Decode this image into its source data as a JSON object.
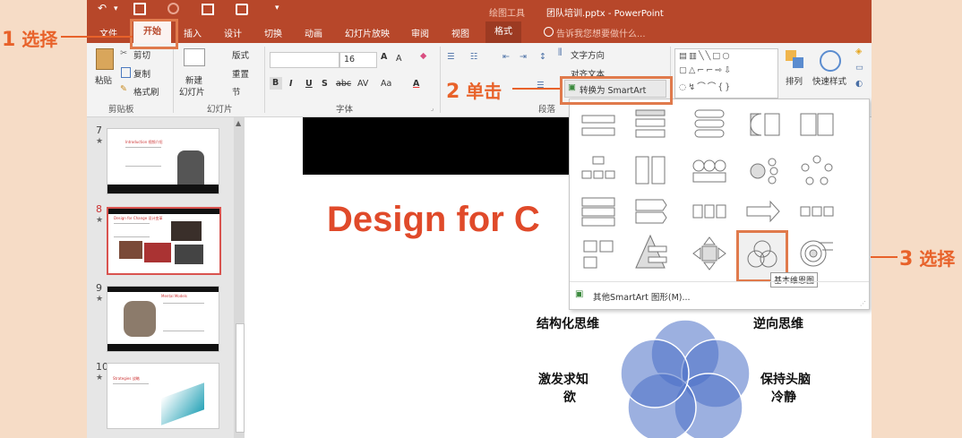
{
  "callouts": {
    "c1": {
      "num": "1",
      "text": "选择"
    },
    "c2": {
      "num": "2",
      "text": "单击"
    },
    "c3": {
      "num": "3",
      "text": "选择"
    }
  },
  "titlebar": {
    "undo": "↶",
    "save": "🖫",
    "tool_context": "绘图工具",
    "title": "团队培训.pptx - PowerPoint"
  },
  "tabs": {
    "file": "文件",
    "home": "开始",
    "insert": "插入",
    "design": "设计",
    "transitions": "切换",
    "animations": "动画",
    "slideshow": "幻灯片放映",
    "review": "审阅",
    "view": "视图",
    "format": "格式",
    "tellme": "告诉我您想要做什么..."
  },
  "ribbon": {
    "clipboard": {
      "paste": "粘贴",
      "cut": "剪切",
      "copy": "复制",
      "format_painter": "格式刷",
      "label": "剪贴板"
    },
    "slides": {
      "layout": "版式",
      "reset": "重置",
      "new_slide": "新建",
      "new_slide2": "幻灯片",
      "section": "节",
      "label": "幻灯片"
    },
    "font": {
      "size": "16",
      "label": "字体",
      "aa": "Aa"
    },
    "paragraph": {
      "text_direction": "文字方向",
      "align_text": "对齐文本",
      "convert_smartart": "转换为 SmartArt",
      "label": "段落"
    },
    "drawing": {
      "arrange": "排列",
      "quick_styles": "快速样式"
    }
  },
  "slides": [
    {
      "num": "7",
      "title": "Introduction 视频介绍"
    },
    {
      "num": "8",
      "title": "Design for Change 设计变革"
    },
    {
      "num": "9",
      "title": "Mental Models"
    },
    {
      "num": "10",
      "title": "Strategies 战略"
    }
  ],
  "slide": {
    "title": "Design for C",
    "labels": {
      "tl": "结构化思维",
      "tr": "逆向思维",
      "ml1": "激发求知",
      "ml2": "欲",
      "mr1": "保持头脑",
      "mr2": "冷静"
    }
  },
  "gallery": {
    "more": "其他SmartArt 图形(M)...",
    "tooltip": "基本维恩图"
  },
  "colors": {
    "accent": "#b7472a",
    "callout": "#e8622a",
    "venn": "#4a6fc7"
  }
}
